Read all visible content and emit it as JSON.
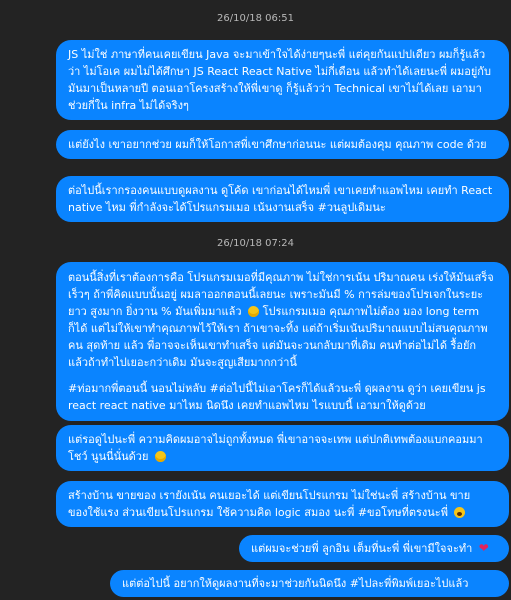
{
  "messages": {
    "ts1": "26/10/18 06:51",
    "m1": "JS ไม่ใช่ ภาษาที่คนเคยเขียน Java จะมาเข้าใจได้ง่ายๆนะพี่ แต่คุยกันแปปเดียว ผมก็รู้แล้วว่า ไม่โอเค ผมไม่ได้ศึกษา JS React React Native ไม่กี่เดือน แล้วทำได้เลยนะพี่ ผมอยู่กับมันมาเป็นหลายปี ตอนเอาโครงสร้างให้พี่เขาดู ก็รู้แล้วว่า Technical เขาไม่ได้เลย เอามาช่วยกี่ใน infra ไม่ได้จริงๆ",
    "m2": "แต่ยังไง เขาอยากช่วย ผมก็ให้โอกาสพี่เขาศึกษาก่อนนะ แต่ผมต้องคุม คุณภาพ code ด้วย",
    "m3": "ต่อไปนี้เรากรองคนแบบดูผลงาน ดูโค้ด เขาก่อนได้ไหมพี่ เขาเคยทำแอพไหม เคยทำ React native ไหม พี่กำลังจะได้โปรแกรมเมอ เน้นงานเสร็จ #วนลูปเดิมนะ",
    "ts2": "26/10/18 07:24",
    "m4_p1": "ตอนนี้สิ่งที่เราต้องการคือ โปรแกรมเมอที่มีคุณภาพ ไม่ใช่การเน้น ปริมาณคน เร่งให้มันเสร็จเร็วๆ ถ้าพี่คิดแบบนั้นอยู่ ผมลาออกตอนนี้เลยนะ เพราะมันมี % การล่มของโปรเจกในระยะยาว สูงมาก ยิ่งวาน % มันเพิ่มมาแล้ว",
    "m4_p1b": "โปรแกรมเมอ คุณภาพไม่ต้อง มอง long term ก็ได้ แต่ไม่ให้เขาทำคุณภาพไว้ให้เรา ถ้าเขาจะทิ้ง แต่ถ้าเริ่มเน้นปริมาณแบบไม่สนคุณภาพคน สุดท้าย แล้ว พี่อาจจะเห็นเขาทำเสร็จ แต่มันจะวนกลับมาที่เดิม คนทำต่อไม่ได้ รื้อยัก แล้วถ้าทำไปเยอะกว่าเดิม มันจะสูญเสียมากกว่านี้",
    "m4_p2": "#ท่อมากพี่ตอนนี้ นอนไม่หลับ #ต่อไปนี้ไม่เอาโครก็ได้แล้วนะพี่ ดูผลงาน ดูว่า เคยเขียน js react react native มาไหม นิดนึง เคยทำแอพไหม ไรแบบนี้ เอามาให้ดูด้วย",
    "m5": "แต่รอดูไปนะพี่ ความคิดผมอาจไม่ถูกทั้งหมด พี่เขาอาจจะเทพ แต่ปกติเทพต้องแบกคอมมาโชว์ นูนนี่นั่นด้วย",
    "m6": "สร้างบ้าน ขายของ เรายังเน้น คนเยอะได้ แต่เขียนโปรแกรม ไม่ใช่นะพี่ สร้างบ้าน ขายของใช้แรง ส่วนเขียนโปรแกรม ใช้ความคิด logic สมอง นะพี่ #ขอโทษที่ตรงนะพี่",
    "m7": "แต่ผมจะช่วยพี่ ลูกอิน เต็มที่นะพี่ พี่เขามีใจจะทำ",
    "m8": "แต่ต่อไปนี้ อยากให้ดูผลงานที่จะมาช่วยกันนิดนึง #ไปละพี่พิมพ์เยอะไปแล้ว"
  },
  "colors": {
    "bubble": "#0a84ff",
    "background": "#232323",
    "timestamp": "#b8b8b8"
  },
  "icons": [
    "grin-sweat-emoji-icon",
    "grin-emoji-icon",
    "scream-emoji-icon",
    "heart-icon"
  ]
}
